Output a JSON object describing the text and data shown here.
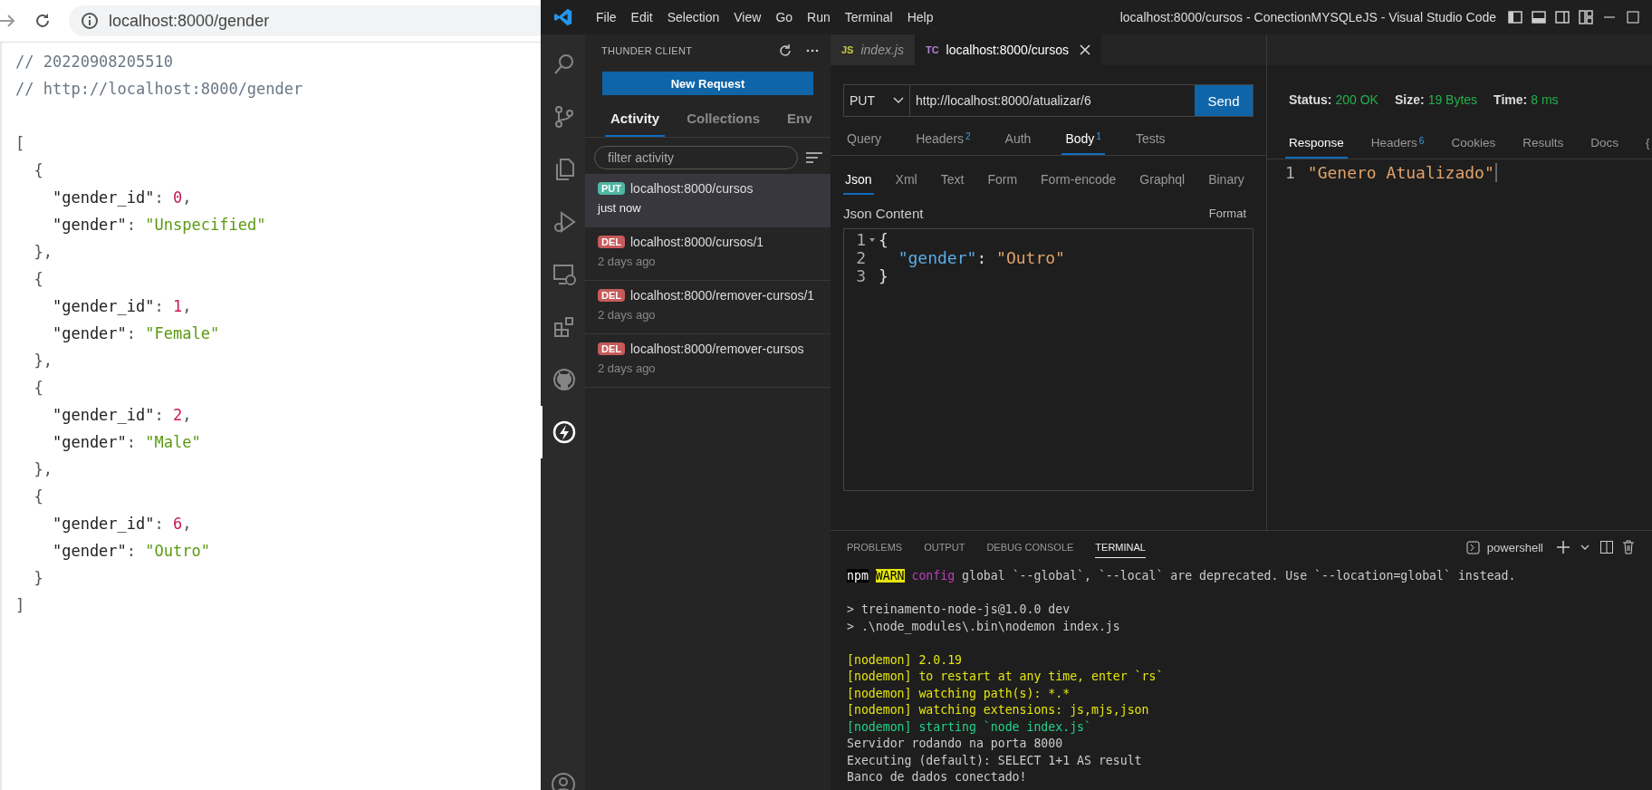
{
  "browser": {
    "address": "localhost:8000/gender",
    "lines": [
      [
        {
          "kind": "comment",
          "text": "// 20220908205510"
        }
      ],
      [
        {
          "kind": "comment",
          "text": "// http://localhost:8000/gender"
        }
      ],
      [
        {
          "kind": "punct",
          "text": "[",
          "space_before": true
        }
      ],
      [
        {
          "kind": "punct",
          "text": "  {"
        }
      ],
      [
        {
          "kind": "key",
          "text": "    \"gender_id\""
        },
        {
          "kind": "punct",
          "text": ": "
        },
        {
          "kind": "number",
          "text": "0"
        },
        {
          "kind": "punct",
          "text": ","
        }
      ],
      [
        {
          "kind": "key",
          "text": "    \"gender\""
        },
        {
          "kind": "punct",
          "text": ": "
        },
        {
          "kind": "string",
          "text": "\"Unspecified\""
        }
      ],
      [
        {
          "kind": "punct",
          "text": "  },"
        }
      ],
      [
        {
          "kind": "punct",
          "text": "  {"
        }
      ],
      [
        {
          "kind": "key",
          "text": "    \"gender_id\""
        },
        {
          "kind": "punct",
          "text": ": "
        },
        {
          "kind": "number",
          "text": "1"
        },
        {
          "kind": "punct",
          "text": ","
        }
      ],
      [
        {
          "kind": "key",
          "text": "    \"gender\""
        },
        {
          "kind": "punct",
          "text": ": "
        },
        {
          "kind": "string",
          "text": "\"Female\""
        }
      ],
      [
        {
          "kind": "punct",
          "text": "  },"
        }
      ],
      [
        {
          "kind": "punct",
          "text": "  {"
        }
      ],
      [
        {
          "kind": "key",
          "text": "    \"gender_id\""
        },
        {
          "kind": "punct",
          "text": ": "
        },
        {
          "kind": "number",
          "text": "2"
        },
        {
          "kind": "punct",
          "text": ","
        }
      ],
      [
        {
          "kind": "key",
          "text": "    \"gender\""
        },
        {
          "kind": "punct",
          "text": ": "
        },
        {
          "kind": "string",
          "text": "\"Male\""
        }
      ],
      [
        {
          "kind": "punct",
          "text": "  },"
        }
      ],
      [
        {
          "kind": "punct",
          "text": "  {"
        }
      ],
      [
        {
          "kind": "key",
          "text": "    \"gender_id\""
        },
        {
          "kind": "punct",
          "text": ": "
        },
        {
          "kind": "number",
          "text": "6"
        },
        {
          "kind": "punct",
          "text": ","
        }
      ],
      [
        {
          "kind": "key",
          "text": "    \"gender\""
        },
        {
          "kind": "punct",
          "text": ": "
        },
        {
          "kind": "string",
          "text": "\"Outro\""
        }
      ],
      [
        {
          "kind": "punct",
          "text": "  }"
        }
      ],
      [
        {
          "kind": "punct",
          "text": "]"
        }
      ]
    ]
  },
  "vscode": {
    "menu": [
      "File",
      "Edit",
      "Selection",
      "View",
      "Go",
      "Run",
      "Terminal",
      "Help"
    ],
    "title": "localhost:8000/cursos - ConectionMYSQLeJS - Visual Studio Code",
    "activity_bar": [
      {
        "kind": "search",
        "selected": false
      },
      {
        "kind": "source-control",
        "selected": false
      },
      {
        "kind": "explorer",
        "selected": false
      },
      {
        "kind": "run-debug",
        "selected": false
      },
      {
        "kind": "remote",
        "selected": false
      },
      {
        "kind": "extensions",
        "selected": false
      },
      {
        "kind": "github",
        "selected": false
      },
      {
        "kind": "thunder",
        "selected": true
      }
    ],
    "sidebar": {
      "title": "THUNDER CLIENT",
      "new_request": "New Request",
      "tabs": [
        {
          "label": "Activity",
          "selected": true
        },
        {
          "label": "Collections",
          "selected": false
        },
        {
          "label": "Env",
          "selected": false
        }
      ],
      "filter": {
        "placeholder": "filter activity"
      },
      "items": [
        {
          "method": "PUT",
          "color": "#4fb7a3",
          "url": "localhost:8000/cursos",
          "time": "just now",
          "selected": true
        },
        {
          "method": "DEL",
          "color": "#c75a5a",
          "url": "localhost:8000/cursos/1",
          "time": "2 days ago",
          "selected": false
        },
        {
          "method": "DEL",
          "color": "#c75a5a",
          "url": "localhost:8000/remover-cursos/1",
          "time": "2 days ago",
          "selected": false
        },
        {
          "method": "DEL",
          "color": "#c75a5a",
          "url": "localhost:8000/remover-cursos",
          "time": "2 days ago",
          "selected": false
        }
      ]
    },
    "editor_tabs": [
      {
        "badge": "JS",
        "color": "#cbcb41",
        "label": "index.js",
        "preview": true,
        "selected": false
      },
      {
        "badge": "TC",
        "color": "#b180d7",
        "label": "localhost:8000/cursos",
        "preview": false,
        "selected": true
      }
    ],
    "request": {
      "method": "PUT",
      "url": "http://localhost:8000/atualizar/6",
      "send": "Send",
      "tabs": [
        {
          "label": "Query",
          "selected": false
        },
        {
          "label": "Headers",
          "count": "2",
          "selected": false
        },
        {
          "label": "Auth",
          "selected": false
        },
        {
          "label": "Body",
          "count": "1",
          "selected": true
        },
        {
          "label": "Tests",
          "selected": false
        }
      ],
      "body_tabs": [
        {
          "label": "Json",
          "selected": true
        },
        {
          "label": "Xml",
          "selected": false
        },
        {
          "label": "Text",
          "selected": false
        },
        {
          "label": "Form",
          "selected": false
        },
        {
          "label": "Form-encode",
          "selected": false
        },
        {
          "label": "Graphql",
          "selected": false
        },
        {
          "label": "Binary",
          "selected": false
        }
      ],
      "content_label": "Json Content",
      "format": "Format",
      "body_lines": [
        {
          "number": "1",
          "fold": true,
          "tokens": [
            {
              "kind": "punct",
              "text": "{"
            }
          ]
        },
        {
          "number": "2",
          "fold": false,
          "tokens": [
            {
              "kind": "key",
              "text": "  \"gender\""
            },
            {
              "kind": "punct",
              "text": ": "
            },
            {
              "kind": "string",
              "text": "\"Outro\""
            }
          ]
        },
        {
          "number": "3",
          "fold": false,
          "tokens": [
            {
              "kind": "punct",
              "text": "}"
            }
          ]
        }
      ]
    },
    "response": {
      "status": [
        {
          "label": "Status:",
          "value": "200 OK"
        },
        {
          "label": "Size:",
          "value": "19 Bytes"
        },
        {
          "label": "Time:",
          "value": "8 ms"
        }
      ],
      "tabs": [
        {
          "label": "Response",
          "selected": true
        },
        {
          "label": "Headers",
          "count": "6",
          "selected": false
        },
        {
          "label": "Cookies",
          "selected": false
        },
        {
          "label": "Results",
          "selected": false
        },
        {
          "label": "Docs",
          "selected": false
        },
        {
          "label": "{",
          "selected": false
        }
      ],
      "lines": [
        {
          "number": "1",
          "text": "\"Genero Atualizado\""
        }
      ]
    },
    "panel": {
      "tabs": [
        {
          "label": "PROBLEMS",
          "selected": false
        },
        {
          "label": "OUTPUT",
          "selected": false
        },
        {
          "label": "DEBUG CONSOLE",
          "selected": false
        },
        {
          "label": "TERMINAL",
          "selected": true
        }
      ],
      "shell": "powershell",
      "terminal": [
        [
          {
            "kind": "inverse",
            "text": "npm"
          },
          {
            "kind": "warn",
            "text": "WARN"
          },
          {
            "kind": "magenta",
            "text": "config"
          },
          {
            "kind": "plain",
            "text": " global `--global`, `--local` are deprecated. Use `--location=global` instead."
          }
        ],
        [
          {
            "kind": "plain",
            "text": "> treinamento-node-js@1.0.0 dev",
            "space_before": true
          }
        ],
        [
          {
            "kind": "plain",
            "text": "> .\\node_modules\\.bin\\nodemon index.js"
          }
        ],
        [
          {
            "kind": "yellow",
            "text": "[nodemon] 2.0.19",
            "space_before": true
          }
        ],
        [
          {
            "kind": "yellow",
            "text": "[nodemon] to restart at any time, enter `rs`"
          }
        ],
        [
          {
            "kind": "yellow",
            "text": "[nodemon] watching path(s): *.*"
          }
        ],
        [
          {
            "kind": "yellow",
            "text": "[nodemon] watching extensions: js,mjs,json"
          }
        ],
        [
          {
            "kind": "green",
            "text": "[nodemon] starting `node index.js`"
          }
        ],
        [
          {
            "kind": "plain",
            "text": "Servidor rodando na porta 8000"
          }
        ],
        [
          {
            "kind": "plain",
            "text": "Executing (default): SELECT 1+1 AS result"
          }
        ],
        [
          {
            "kind": "plain",
            "text": "Banco de dados conectado!"
          }
        ]
      ]
    }
  }
}
